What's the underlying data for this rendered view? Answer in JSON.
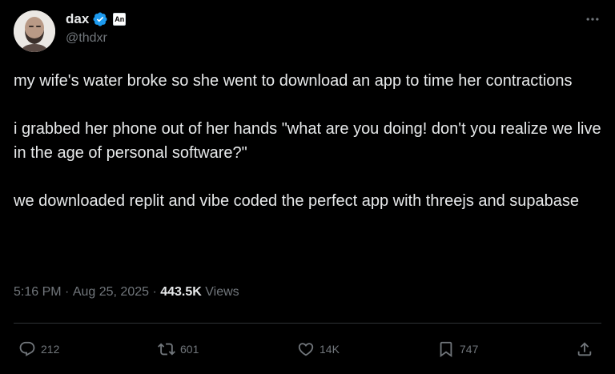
{
  "author": {
    "display_name": "dax",
    "handle": "@thdxr",
    "affiliate_badge": "An",
    "avatar_icon": "avatar-photo",
    "verified_icon": "verified-badge-icon",
    "verified_color": "#1d9bf0"
  },
  "tweet": {
    "paragraphs": [
      "my wife's water broke so she went to download an app to time her contractions",
      "i grabbed her phone out of her hands \"what are you doing! don't you realize we live in the age of personal software?\"",
      "we downloaded replit and vibe coded the perfect app with threejs and supabase"
    ]
  },
  "meta": {
    "time": "5:16 PM",
    "separator": " · ",
    "date": "Aug 25, 2025",
    "views_count": "443.5K",
    "views_label": " Views"
  },
  "actions": {
    "reply_count": "212",
    "repost_count": "601",
    "like_count": "14K",
    "bookmark_count": "747"
  },
  "colors": {
    "background": "#000000",
    "text": "#e7e9ea",
    "secondary": "#71767b",
    "divider": "#2f3336",
    "accent": "#1d9bf0"
  }
}
